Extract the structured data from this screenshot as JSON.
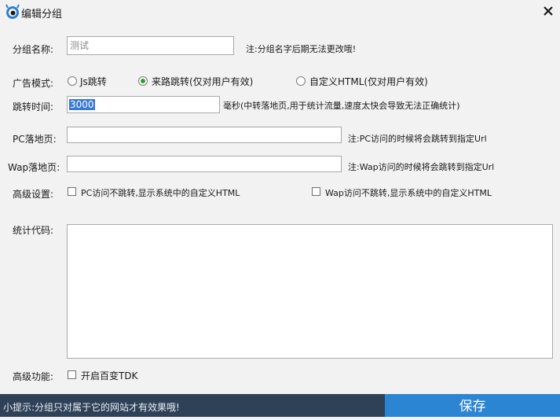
{
  "window": {
    "title": "编辑分组",
    "close_icon": "close-icon",
    "app_icon": "eye-logo-icon"
  },
  "group_name": {
    "label": "分组名称:",
    "placeholder": "测试",
    "note": "注:分组名字后期无法更改哦!"
  },
  "ad_mode": {
    "label": "广告模式:",
    "options": [
      {
        "label": "Js跳转",
        "checked": false
      },
      {
        "label": "来路跳转(仅对用户有效)",
        "checked": true
      },
      {
        "label": "自定义HTML(仅对用户有效)",
        "checked": false
      }
    ]
  },
  "jump_time": {
    "label": "跳转时间:",
    "value": "3000",
    "note": "毫秒(中转落地页,用于统计流量,速度太快会导致无法正确统计)"
  },
  "pc_landing": {
    "label": "PC落地页:",
    "value": "",
    "note": "注:PC访问的时候将会跳转到指定Url"
  },
  "wap_landing": {
    "label": "Wap落地页:",
    "value": "",
    "note": "注:Wap访问的时候将会跳转到指定Url"
  },
  "advanced_settings": {
    "label": "高级设置:",
    "pc_option": "PC访问不跳转,显示系统中的自定义HTML",
    "wap_option": "Wap访问不跳转,显示系统中的自定义HTML"
  },
  "stats_code": {
    "label": "统计代码:",
    "value": ""
  },
  "advanced_features": {
    "label": "高级功能:",
    "tdk_option": "开启百变TDK"
  },
  "footer": {
    "tip": "小提示:分组只对属于它的网站才有效果哦!",
    "save_label": "保存"
  },
  "colors": {
    "footer_bg": "#2e4157",
    "save_bg": "#2c85d3",
    "radio_checked": "#2f9d3a",
    "selection": "#3a78d8"
  }
}
